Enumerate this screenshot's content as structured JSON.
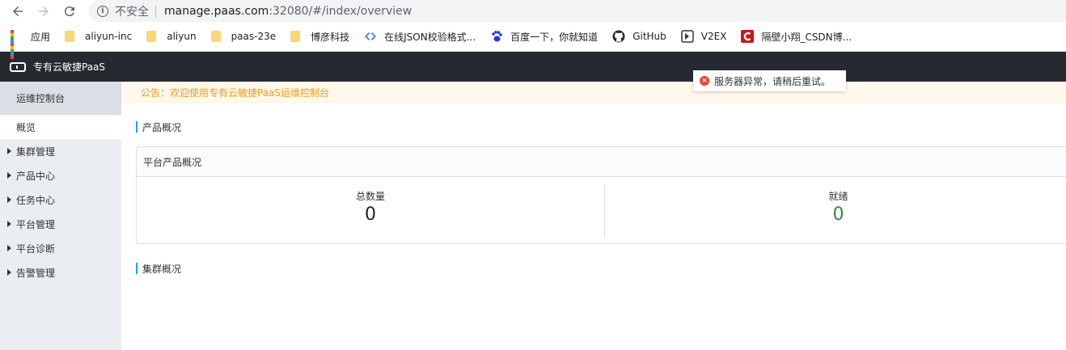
{
  "browser": {
    "insecure_label": "不安全",
    "url_host": "manage.paas.com",
    "url_rest": ":32080/#/index/overview"
  },
  "bookmarks": [
    {
      "label": "应用",
      "icon": "apps-grid-icon"
    },
    {
      "label": "aliyun-inc",
      "icon": "folder-icon"
    },
    {
      "label": "aliyun",
      "icon": "folder-icon"
    },
    {
      "label": "paas-23e",
      "icon": "folder-icon"
    },
    {
      "label": "博彦科技",
      "icon": "folder-icon"
    },
    {
      "label": "在线JSON校验格式...",
      "icon": "code-icon"
    },
    {
      "label": "百度一下，你就知道",
      "icon": "baidu-paw-icon"
    },
    {
      "label": "GitHub",
      "icon": "github-icon"
    },
    {
      "label": "V2EX",
      "icon": "v2ex-icon"
    },
    {
      "label": "隔壁小翔_CSDN博...",
      "icon": "csdn-icon"
    }
  ],
  "app": {
    "title": "专有云敏捷PaaS"
  },
  "sidebar": {
    "header": "运维控制台",
    "items": [
      {
        "label": "概览",
        "active": true,
        "expandable": false
      },
      {
        "label": "集群管理",
        "active": false,
        "expandable": true
      },
      {
        "label": "产品中心",
        "active": false,
        "expandable": true
      },
      {
        "label": "任务中心",
        "active": false,
        "expandable": true
      },
      {
        "label": "平台管理",
        "active": false,
        "expandable": true
      },
      {
        "label": "平台诊断",
        "active": false,
        "expandable": true
      },
      {
        "label": "告警管理",
        "active": false,
        "expandable": true
      }
    ]
  },
  "main": {
    "notice": "公告：欢迎使用专有云敏捷PaaS运维控制台",
    "product_section_title": "产品概况",
    "card_title": "平台产品概况",
    "stats": [
      {
        "label": "总数量",
        "value": "0"
      },
      {
        "label": "就绪",
        "value": "0"
      }
    ],
    "cluster_section_title": "集群概况"
  },
  "toast": {
    "message": "服务器异常，请稍后重试。"
  },
  "colors": {
    "header_bg": "#262a30",
    "sidebar_bg": "#eaedf1",
    "notice_text": "#f39c12",
    "accent": "#00a8e6",
    "ready_value": "#2e8b3d",
    "error": "#f04134"
  }
}
